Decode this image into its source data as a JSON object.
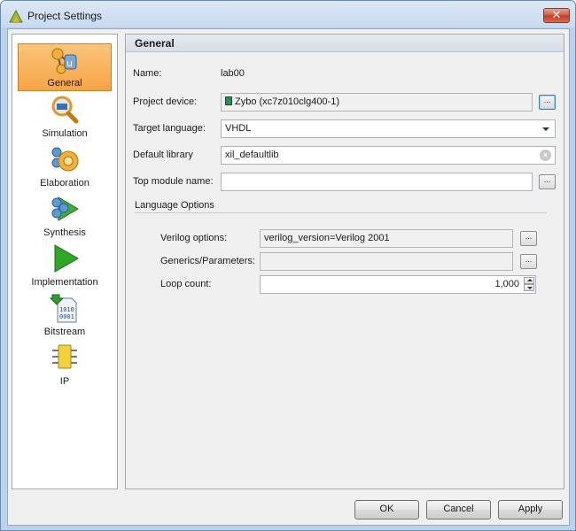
{
  "window": {
    "title": "Project Settings",
    "close_label": "✕"
  },
  "sidebar": {
    "items": [
      {
        "label": "General",
        "icon": "general-icon",
        "selected": true
      },
      {
        "label": "Simulation",
        "icon": "magnifier-icon"
      },
      {
        "label": "Elaboration",
        "icon": "elaboration-icon"
      },
      {
        "label": "Synthesis",
        "icon": "synthesis-icon"
      },
      {
        "label": "Implementation",
        "icon": "play-arrow-icon"
      },
      {
        "label": "Bitstream",
        "icon": "bitstream-file-icon"
      },
      {
        "label": "IP",
        "icon": "chip-icon"
      }
    ]
  },
  "panel": {
    "title": "General",
    "name_label": "Name:",
    "name_value": "lab00",
    "device_label": "Project device:",
    "device_value": "Zybo (xc7z010clg400-1)",
    "browse_label": "...",
    "target_language_label": "Target language:",
    "target_language_value": "VHDL",
    "default_library_label": "Default library",
    "default_library_value": "xil_defaultlib",
    "top_module_label": "Top module name:",
    "top_module_value": "",
    "language_options": {
      "title": "Language Options",
      "verilog_label": "Verilog options:",
      "verilog_value": "verilog_version=Verilog 2001",
      "generics_label": "Generics/Parameters:",
      "generics_value": "",
      "loop_label": "Loop count:",
      "loop_value": "1,000"
    }
  },
  "buttons": {
    "ok": "OK",
    "cancel": "Cancel",
    "apply": "Apply"
  }
}
